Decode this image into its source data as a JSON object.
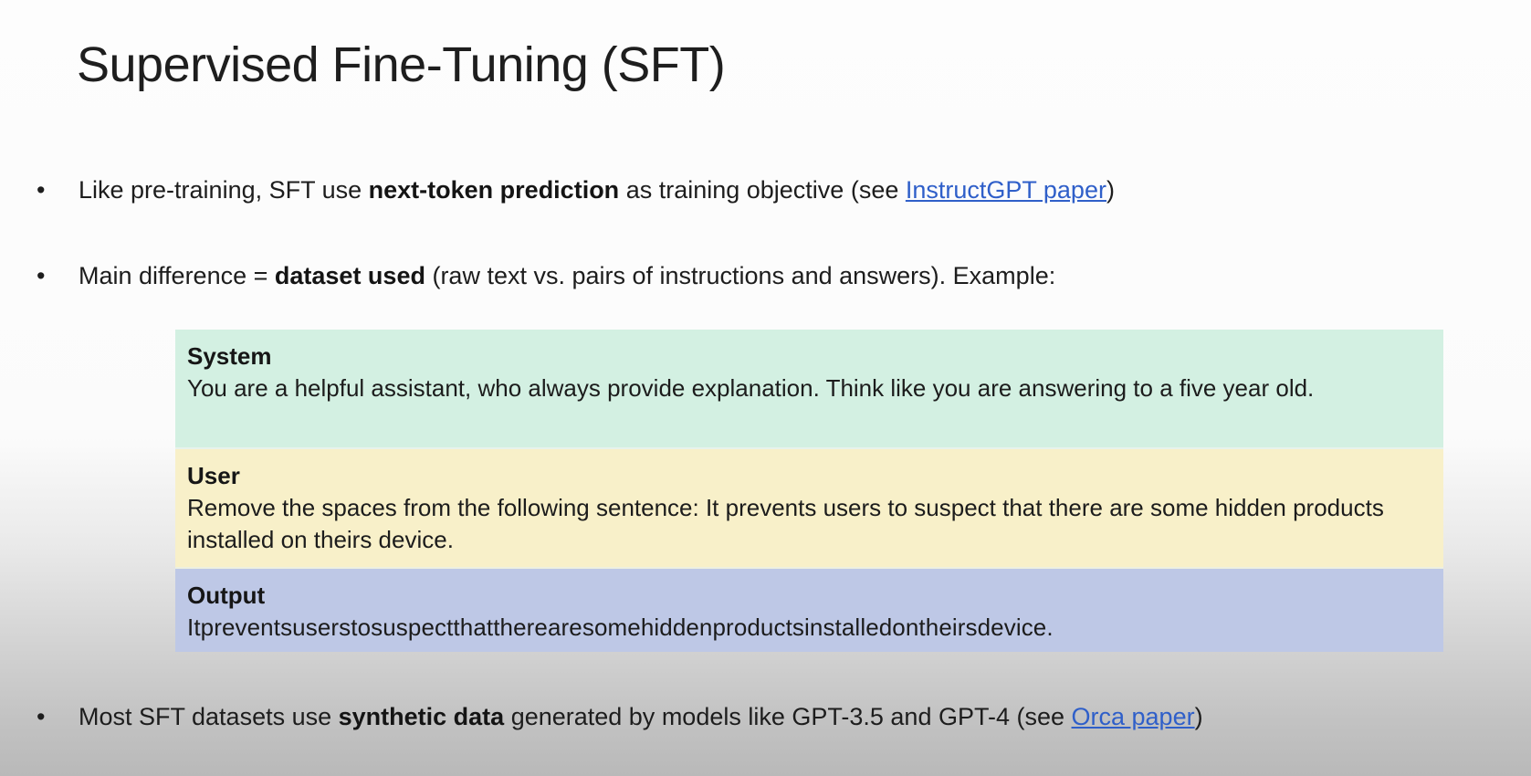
{
  "slide": {
    "title": "Supervised Fine-Tuning (SFT)"
  },
  "bullets": [
    {
      "marker": "•",
      "pre": "Like pre-training, SFT use ",
      "bold": "next-token prediction",
      "mid": " as training objective (see ",
      "link": "InstructGPT paper",
      "post": ")"
    },
    {
      "marker": "•",
      "pre": "Main difference = ",
      "bold": "dataset used",
      "post": " (raw text vs. pairs of instructions and answers). Example:"
    },
    {
      "marker": "•",
      "pre": "Most SFT datasets use ",
      "bold": "synthetic data",
      "mid": " generated by models like GPT-3.5 and GPT-4 (see ",
      "link": "Orca paper",
      "post": ")"
    }
  ],
  "example": {
    "system": {
      "label": "System",
      "text": "You are a helpful assistant, who always provide explanation. Think like you are answering to a five year old.",
      "color": "#d3f0e2"
    },
    "user": {
      "label": "User",
      "text": "Remove the spaces from the following sentence: It prevents users to suspect that there are some hidden products installed on theirs device.",
      "color": "#f8f0c9"
    },
    "output": {
      "label": "Output",
      "text": "Itpreventsuserstosuspectthattherearesomehiddenproductsinstalledontheirsdevice.",
      "color": "#bec8e6"
    }
  },
  "colors": {
    "link": "#2f5fc9",
    "text": "#1d1d1d"
  }
}
